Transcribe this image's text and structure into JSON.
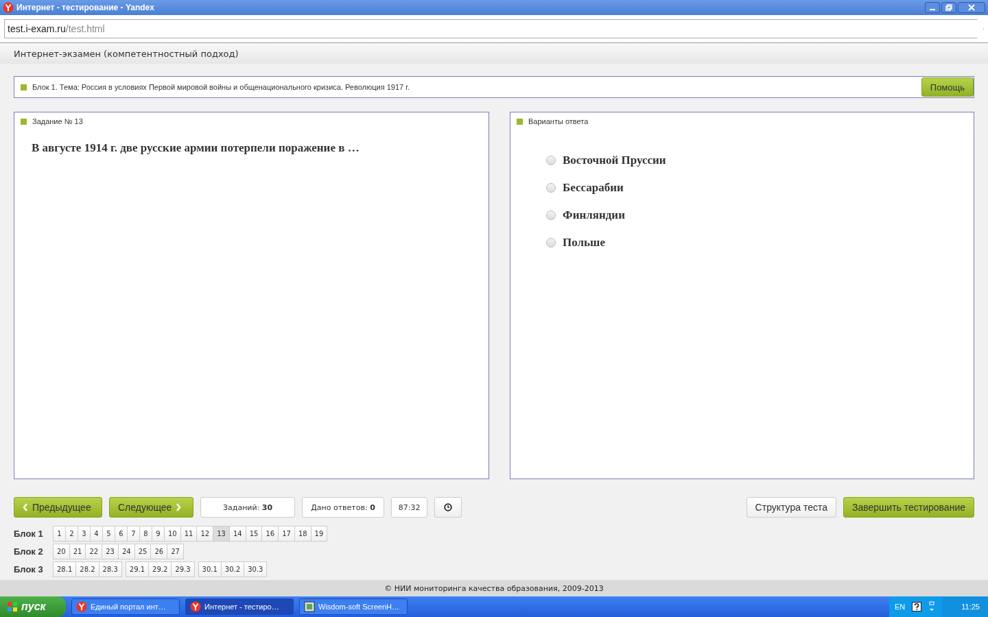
{
  "window": {
    "title": "Интернет - тестирование - Yandex"
  },
  "address": {
    "host": "test.i-exam.ru",
    "path": "/test.html"
  },
  "header": {
    "title": "Интернет-экзамен (компетентностный подход)"
  },
  "topic": {
    "text": "Блок 1. Тема: Россия в условиях Первой мировой войны и общенационального кризиса. Революция 1917 г.",
    "help_button": "Помощь"
  },
  "task": {
    "heading": "Задание № 13",
    "question": "В августе 1914 г. две русские армии потерпели поражение в …"
  },
  "answers": {
    "heading": "Варианты ответа",
    "options": [
      {
        "label": "Восточной Пруссии",
        "selected": false
      },
      {
        "label": "Бессарабии",
        "selected": false
      },
      {
        "label": "Финляндии",
        "selected": false
      },
      {
        "label": "Польше",
        "selected": false
      }
    ]
  },
  "controls": {
    "prev": "Предыдущее",
    "next": "Следующее",
    "tasks_label": "Заданий:",
    "tasks_value": "30",
    "answered_label": "Дано ответов:",
    "answered_value": "0",
    "timer": "87:32",
    "structure": "Структура теста",
    "finish": "Завершить тестирование"
  },
  "blocks": [
    {
      "label": "Блок 1",
      "groups": [
        [
          {
            "n": "1",
            "selected": false
          },
          {
            "n": "2",
            "selected": false
          },
          {
            "n": "3",
            "selected": false
          },
          {
            "n": "4",
            "selected": false
          },
          {
            "n": "5",
            "selected": false
          },
          {
            "n": "6",
            "selected": false
          },
          {
            "n": "7",
            "selected": false
          },
          {
            "n": "8",
            "selected": false
          },
          {
            "n": "9",
            "selected": false
          },
          {
            "n": "10",
            "selected": false
          },
          {
            "n": "11",
            "selected": false
          },
          {
            "n": "12",
            "selected": false
          },
          {
            "n": "13",
            "selected": true
          },
          {
            "n": "14",
            "selected": false
          },
          {
            "n": "15",
            "selected": false
          },
          {
            "n": "16",
            "selected": false
          },
          {
            "n": "17",
            "selected": false
          },
          {
            "n": "18",
            "selected": false
          },
          {
            "n": "19",
            "selected": false
          }
        ]
      ]
    },
    {
      "label": "Блок 2",
      "groups": [
        [
          {
            "n": "20",
            "selected": false
          },
          {
            "n": "21",
            "selected": false
          },
          {
            "n": "22",
            "selected": false
          },
          {
            "n": "23",
            "selected": false
          },
          {
            "n": "24",
            "selected": false
          },
          {
            "n": "25",
            "selected": false
          },
          {
            "n": "26",
            "selected": false
          },
          {
            "n": "27",
            "selected": false
          }
        ]
      ]
    },
    {
      "label": "Блок 3",
      "groups": [
        [
          {
            "n": "28.1",
            "selected": false
          },
          {
            "n": "28.2",
            "selected": false
          },
          {
            "n": "28.3",
            "selected": false
          }
        ],
        [
          {
            "n": "29.1",
            "selected": false
          },
          {
            "n": "29.2",
            "selected": false
          },
          {
            "n": "29.3",
            "selected": false
          }
        ],
        [
          {
            "n": "30.1",
            "selected": false
          },
          {
            "n": "30.2",
            "selected": false
          },
          {
            "n": "30.3",
            "selected": false
          }
        ]
      ]
    }
  ],
  "footer": {
    "text": "© НИИ мониторинга качества образования, 2009-2013"
  },
  "taskbar": {
    "start": "пуск",
    "tasks": [
      {
        "label": "Единый портал инт…",
        "kind": "browser",
        "selected": false
      },
      {
        "label": "Интернет - тестиро…",
        "kind": "browser",
        "selected": true
      },
      {
        "label": "Wisdom-soft ScreenH…",
        "kind": "app",
        "selected": false
      }
    ],
    "lang": "EN",
    "clock": "11:25"
  }
}
